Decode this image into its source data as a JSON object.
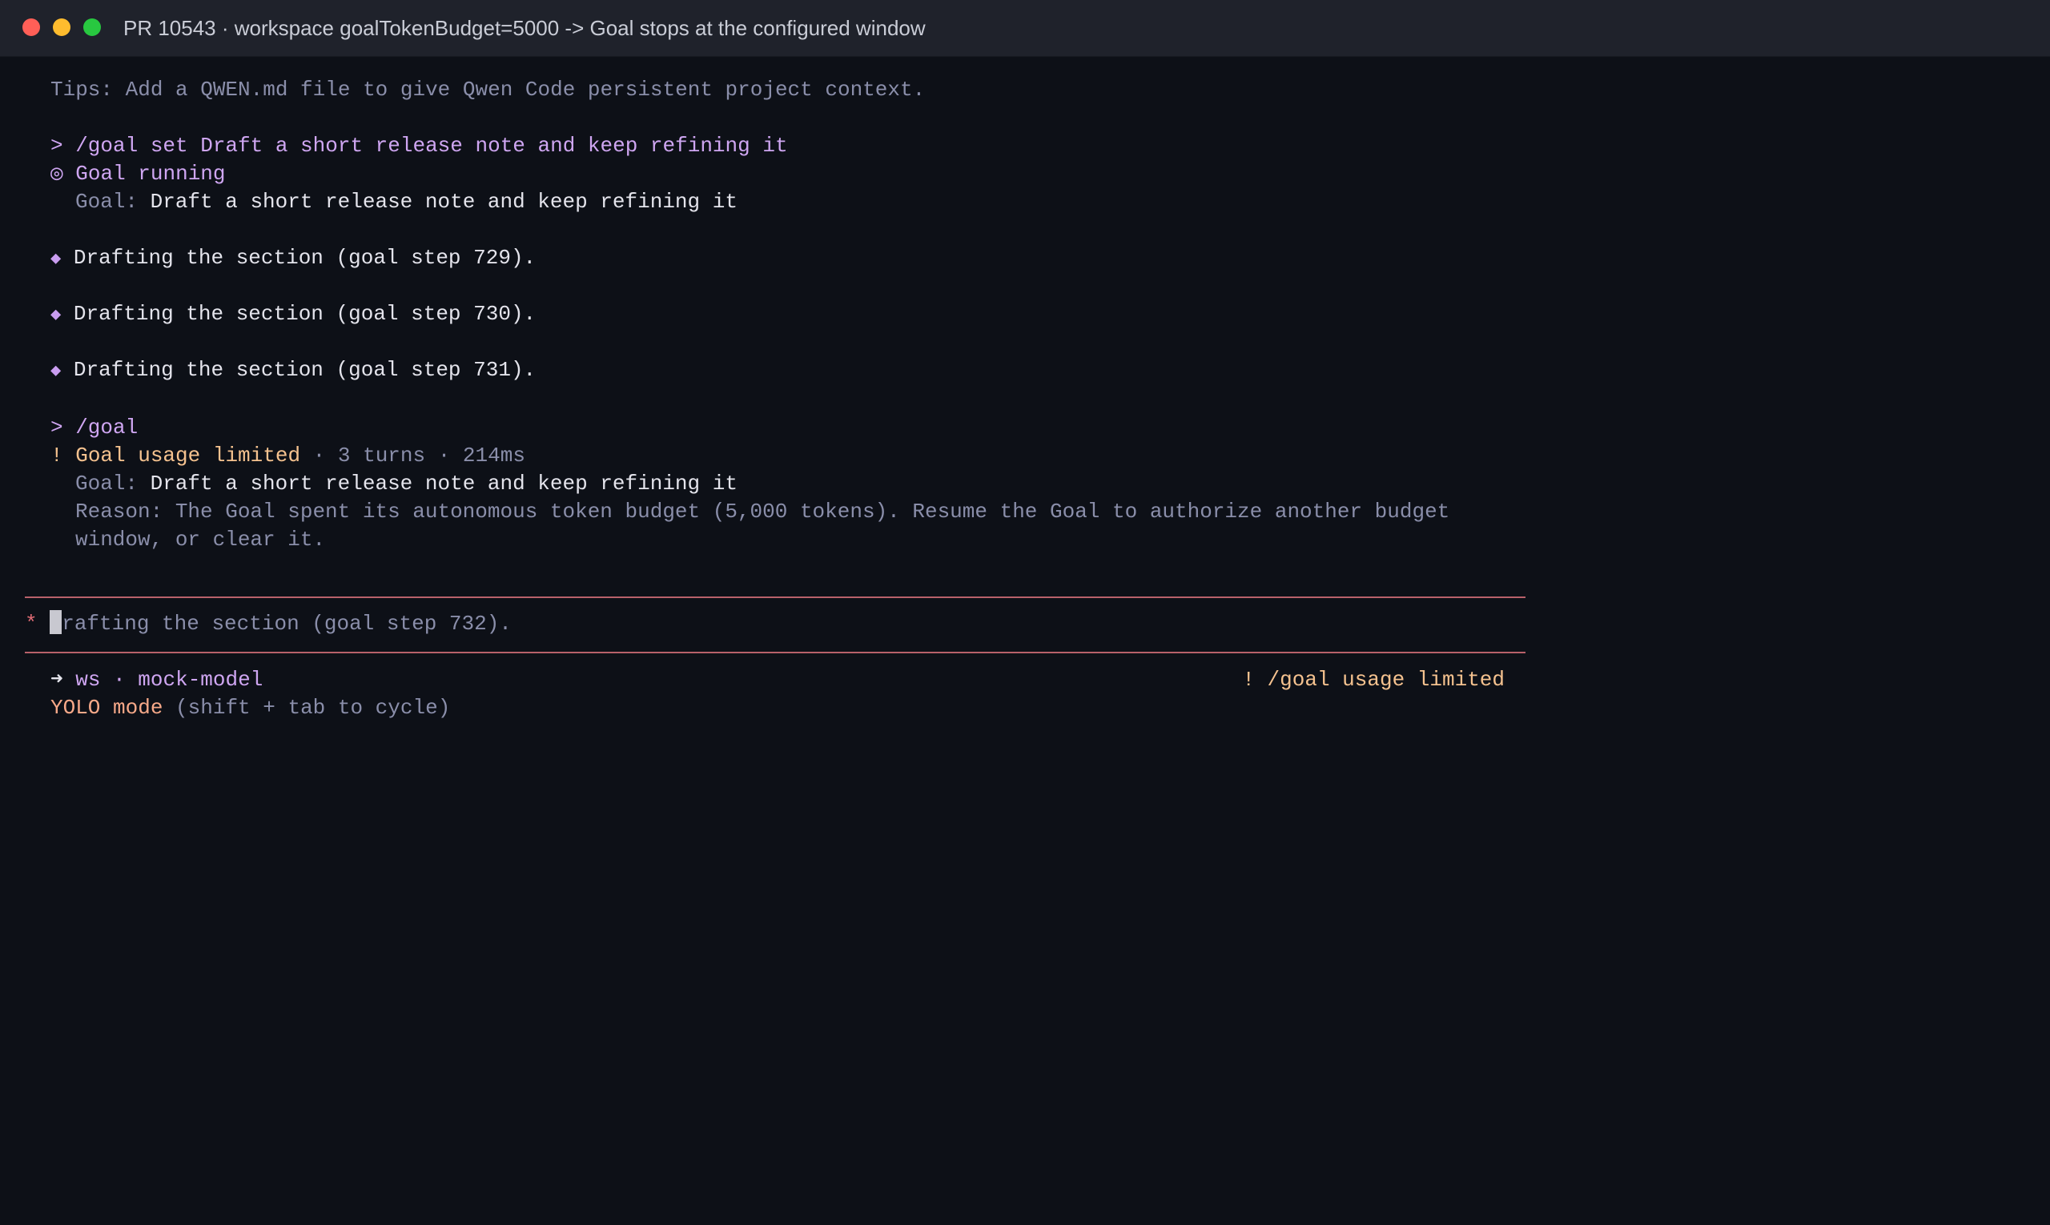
{
  "window": {
    "title": "PR 10543 · workspace goalTokenBudget=5000 -> Goal stops at the configured window"
  },
  "colors": {
    "background": "#0d1017",
    "titlebar": "#1f222b",
    "accent_purple": "#cfa6f2",
    "warning_orange": "#f5c28f",
    "yolo": "#f7a989",
    "rule": "#b8616a",
    "muted": "#8a8eaa"
  },
  "tips": "Tips: Add a QWEN.md file to give Qwen Code persistent project context.",
  "session1": {
    "prompt": "> /goal set Draft a short release note and keep refining it",
    "status_icon": "◎",
    "status_text": "Goal running",
    "goal_label": "Goal:",
    "goal_value": "Draft a short release note and keep refining it"
  },
  "steps": [
    {
      "icon": "◆",
      "text": "Drafting the section (goal step 729)."
    },
    {
      "icon": "◆",
      "text": "Drafting the section (goal step 730)."
    },
    {
      "icon": "◆",
      "text": "Drafting the section (goal step 731)."
    }
  ],
  "session2": {
    "prompt": "> /goal",
    "warn_icon": "!",
    "status_text": "Goal usage limited",
    "status_meta": " · 3 turns · 214ms",
    "goal_label": "Goal:",
    "goal_value": "Draft a short release note and keep refining it",
    "reason_line1": "Reason: The Goal spent its autonomous token budget (5,000 tokens). Resume the Goal to authorize another budget",
    "reason_line2": "window, or clear it."
  },
  "input": {
    "marker": "*",
    "cursor_char": "D",
    "text": "rafting the section (goal step 732)."
  },
  "footer": {
    "arrow_icon": "➜",
    "context": "ws · mock-model",
    "right_status": "! /goal usage limited",
    "mode_label": "YOLO mode",
    "mode_hint": " (shift + tab to cycle)"
  }
}
